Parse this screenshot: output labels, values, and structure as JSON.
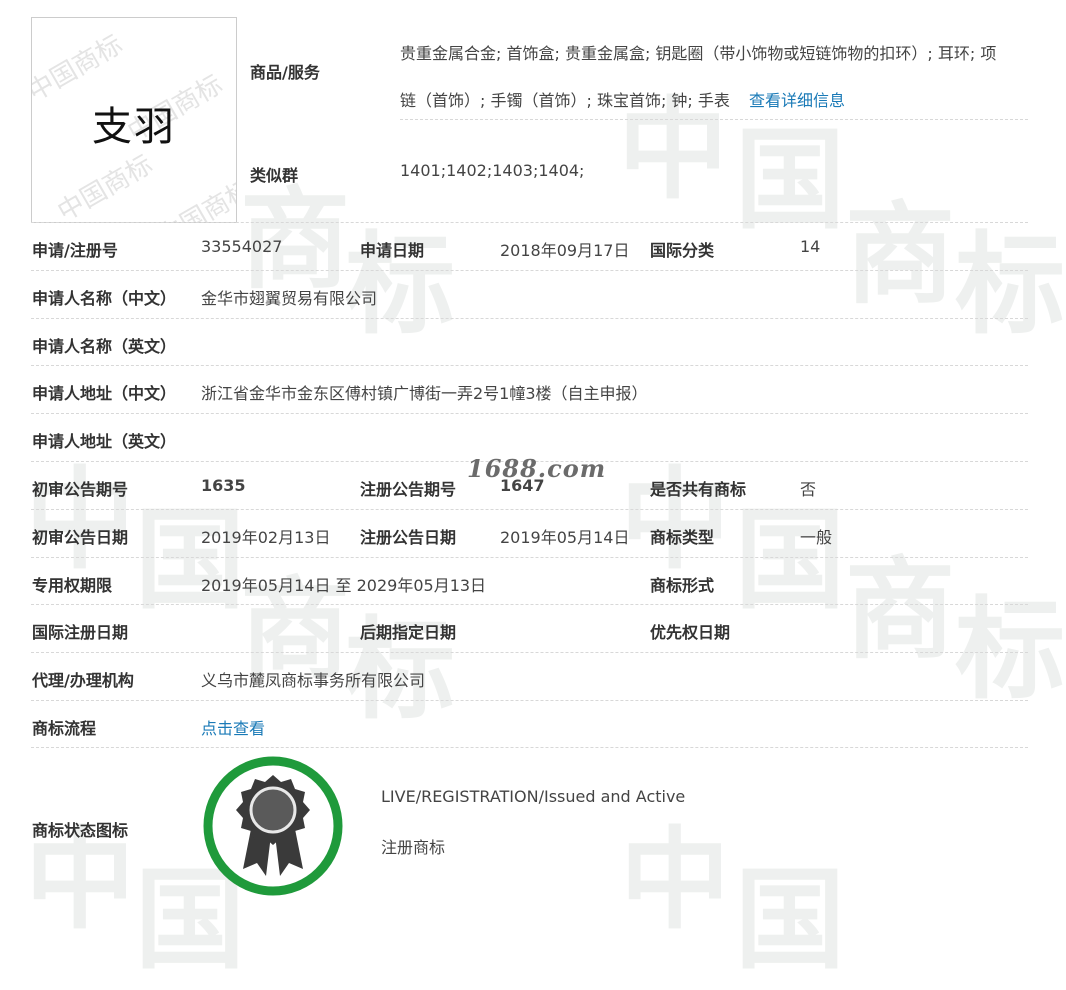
{
  "logo": {
    "mark_text": "支羽",
    "watermark_text": "中国商标"
  },
  "site_watermark": "1688.com",
  "goods": {
    "label": "商品/服务",
    "line1": "贵重金属合金; 首饰盒; 贵重金属盒; 钥匙圈（带小饰物或短链饰物的扣环）; 耳环; 项",
    "line2": "链（首饰）; 手镯（首饰）; 珠宝首饰; 钟; 手表",
    "detail_link": "查看详细信息"
  },
  "similar_group": {
    "label": "类似群",
    "value": "1401;1402;1403;1404;"
  },
  "rows": {
    "reg_no": {
      "label": "申请/注册号",
      "value": "33554027"
    },
    "apply_date": {
      "label": "申请日期",
      "value": "2018年09月17日"
    },
    "intl_class": {
      "label": "国际分类",
      "value": "14"
    },
    "applicant_cn": {
      "label": "申请人名称（中文）",
      "value": "金华市翅翼贸易有限公司"
    },
    "applicant_en": {
      "label": "申请人名称（英文）",
      "value": ""
    },
    "address_cn": {
      "label": "申请人地址（中文）",
      "value": "浙江省金华市金东区傅村镇广博街一弄2号1幢3楼（自主申报）"
    },
    "address_en": {
      "label": "申请人地址（英文）",
      "value": ""
    },
    "prelim_no": {
      "label": "初审公告期号",
      "value": "1635"
    },
    "reg_pub_no": {
      "label": "注册公告期号",
      "value": "1647"
    },
    "shared": {
      "label": "是否共有商标",
      "value": "否"
    },
    "prelim_date": {
      "label": "初审公告日期",
      "value": "2019年02月13日"
    },
    "reg_pub_date": {
      "label": "注册公告日期",
      "value": "2019年05月14日"
    },
    "tm_type": {
      "label": "商标类型",
      "value": "一般"
    },
    "exclusive_period": {
      "label": "专用权期限",
      "value": "2019年05月14日 至 2029年05月13日"
    },
    "tm_form": {
      "label": "商标形式",
      "value": ""
    },
    "intl_reg_date": {
      "label": "国际注册日期",
      "value": ""
    },
    "later_date": {
      "label": "后期指定日期",
      "value": ""
    },
    "priority_date": {
      "label": "优先权日期",
      "value": ""
    },
    "agent": {
      "label": "代理/办理机构",
      "value": "义乌市麓凤商标事务所有限公司"
    },
    "flow": {
      "label": "商标流程",
      "link": "点击查看"
    }
  },
  "status": {
    "label": "商标状态图标",
    "line1": "LIVE/REGISTRATION/Issued and Active",
    "line2": "注册商标"
  },
  "colors": {
    "link": "#1a7ab7",
    "status_ring": "#1f9a3b",
    "badge": "#3a3a3a"
  }
}
